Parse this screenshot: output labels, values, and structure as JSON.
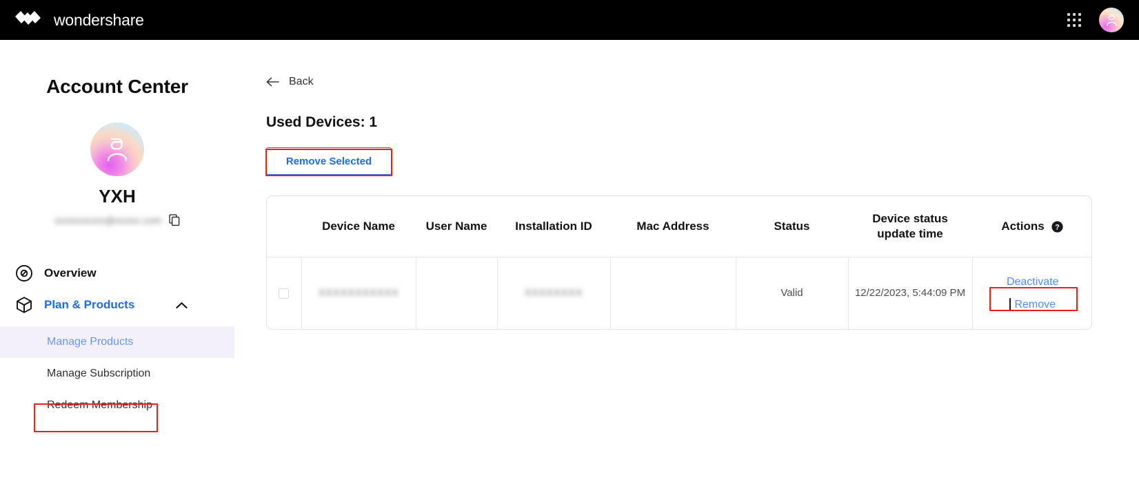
{
  "header": {
    "brand_name": "wondershare",
    "grid_icon": "apps-grid-icon",
    "avatar_icon": "user-avatar-icon"
  },
  "sidebar": {
    "title": "Account Center",
    "user_name": "YXH",
    "user_email_redacted": "xxxxxxxxxx@xxxxx.com",
    "copy_icon": "copy-icon",
    "nav": [
      {
        "label": "Overview",
        "icon": "compass-icon",
        "active": false
      },
      {
        "label": "Plan & Products",
        "icon": "box-icon",
        "active": true,
        "expanded": true,
        "caret": "chevron-up-icon"
      }
    ],
    "subnav": [
      {
        "label": "Manage Products",
        "selected": true
      },
      {
        "label": "Manage Subscription",
        "selected": false
      },
      {
        "label": "Redeem Membership",
        "selected": false
      }
    ]
  },
  "main": {
    "back_label": "Back",
    "back_icon": "arrow-left-icon",
    "used_devices_label": "Used Devices: 1",
    "remove_selected_label": "Remove Selected",
    "table": {
      "columns": [
        "",
        "Device Name",
        "User Name",
        "Installation ID",
        "Mac Address",
        "Status",
        "Device status update time",
        "Actions"
      ],
      "actions_help_icon": "question-mark-circle-icon",
      "rows": [
        {
          "checked": false,
          "device_name": "XXXXXXXXXXX",
          "user_name": "",
          "installation_id": "XXXXXXXX",
          "mac_address": "",
          "status": "Valid",
          "status_update_time": "12/22/2023, 5:44:09 PM",
          "actions": {
            "deactivate": "Deactivate",
            "remove": "Remove"
          }
        }
      ]
    }
  },
  "colors": {
    "accent_blue": "#1b6cf2",
    "link_blue": "#4b8df8",
    "annotation_red": "#ee1d1d",
    "header_black": "#000000",
    "selected_bg": "#f3f0fb"
  }
}
